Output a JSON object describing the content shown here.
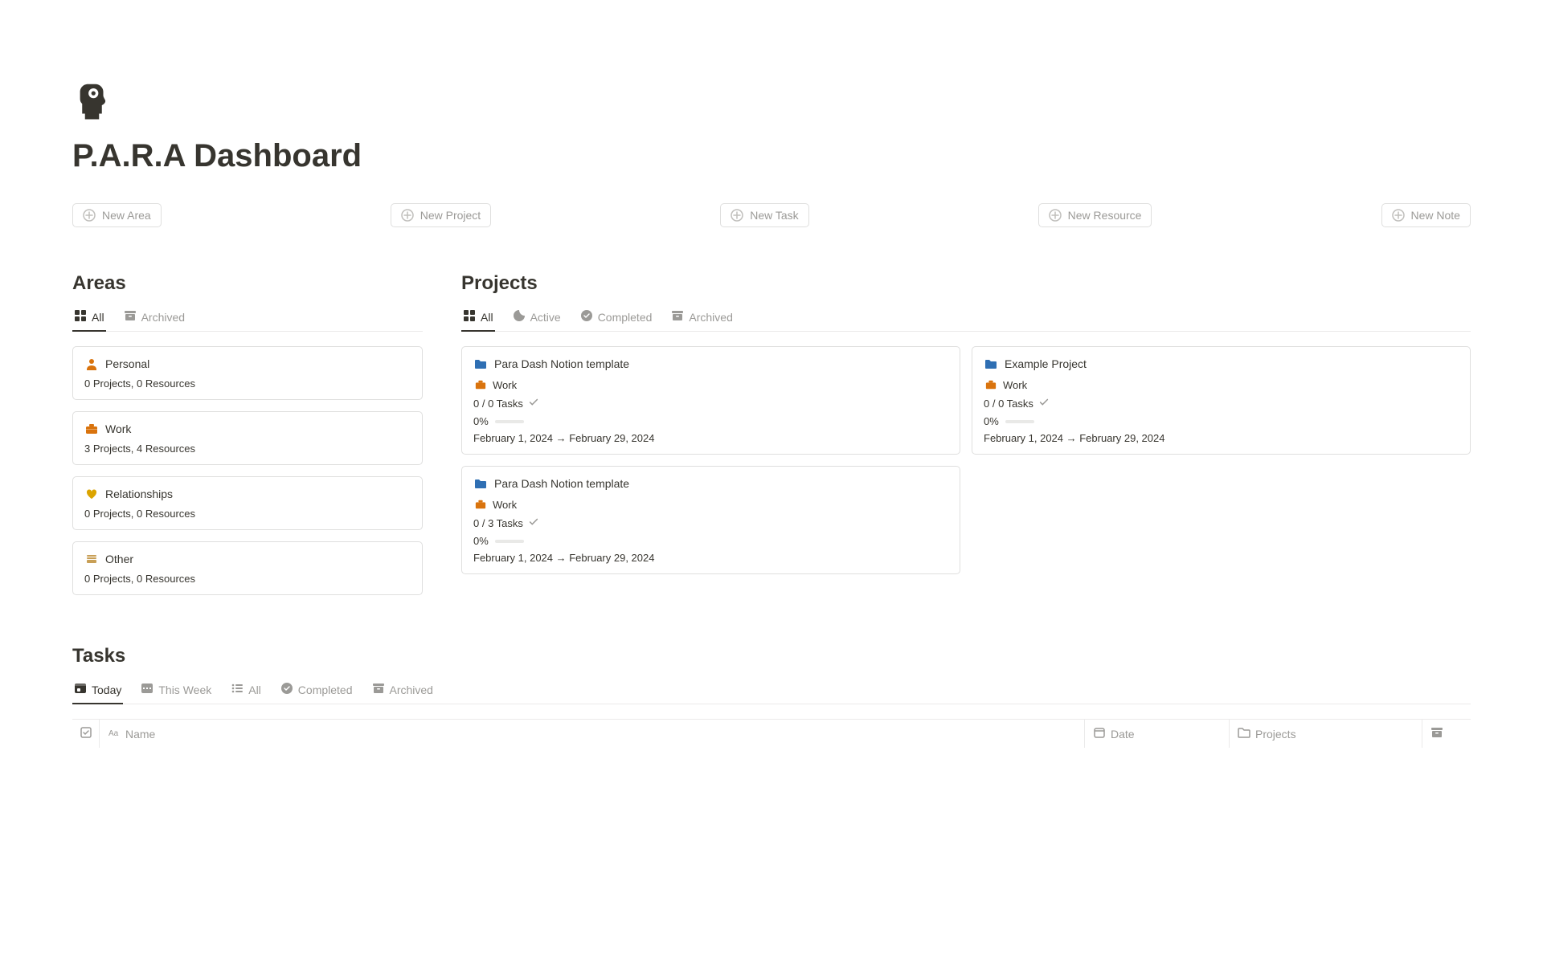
{
  "page": {
    "title": "P.A.R.A Dashboard"
  },
  "actions": [
    {
      "label": "New Area"
    },
    {
      "label": "New Project"
    },
    {
      "label": "New Task"
    },
    {
      "label": "New Resource"
    },
    {
      "label": "New Note"
    }
  ],
  "areas": {
    "heading": "Areas",
    "tabs": [
      {
        "label": "All",
        "active": true,
        "icon": "gallery"
      },
      {
        "label": "Archived",
        "active": false,
        "icon": "archive"
      }
    ],
    "cards": [
      {
        "icon": "person",
        "icon_color": "#d9730d",
        "title": "Personal",
        "meta": "0 Projects, 0 Resources"
      },
      {
        "icon": "briefcase",
        "icon_color": "#d9730d",
        "title": "Work",
        "meta": "3 Projects, 4 Resources"
      },
      {
        "icon": "heart",
        "icon_color": "#dba400",
        "title": "Relationships",
        "meta": "0 Projects, 0 Resources"
      },
      {
        "icon": "folder-stack",
        "icon_color": "#c89f56",
        "title": "Other",
        "meta": "0 Projects, 0 Resources"
      }
    ]
  },
  "projects": {
    "heading": "Projects",
    "tabs": [
      {
        "label": "All",
        "active": true,
        "icon": "gallery"
      },
      {
        "label": "Active",
        "active": false,
        "icon": "moon"
      },
      {
        "label": "Completed",
        "active": false,
        "icon": "check-circle"
      },
      {
        "label": "Archived",
        "active": false,
        "icon": "archive"
      }
    ],
    "cards": [
      {
        "title": "Para Dash Notion template",
        "area": "Work",
        "tasks_text": "0 / 0 Tasks",
        "percent": "0%",
        "dates": "February 1, 2024 → February 29, 2024"
      },
      {
        "title": "Example Project",
        "area": "Work",
        "tasks_text": "0 / 0 Tasks",
        "percent": "0%",
        "dates": "February 1, 2024 → February 29, 2024"
      },
      {
        "title": "Para Dash Notion template",
        "area": "Work",
        "tasks_text": "0 / 3 Tasks",
        "percent": "0%",
        "dates": "February 1, 2024 → February 29, 2024"
      }
    ]
  },
  "tasks": {
    "heading": "Tasks",
    "tabs": [
      {
        "label": "Today",
        "active": true,
        "icon": "calendar-day"
      },
      {
        "label": "This Week",
        "active": false,
        "icon": "calendar-week"
      },
      {
        "label": "All",
        "active": false,
        "icon": "list"
      },
      {
        "label": "Completed",
        "active": false,
        "icon": "check-circle"
      },
      {
        "label": "Archived",
        "active": false,
        "icon": "archive"
      }
    ],
    "columns": {
      "name": "Name",
      "date": "Date",
      "projects": "Projects"
    }
  }
}
